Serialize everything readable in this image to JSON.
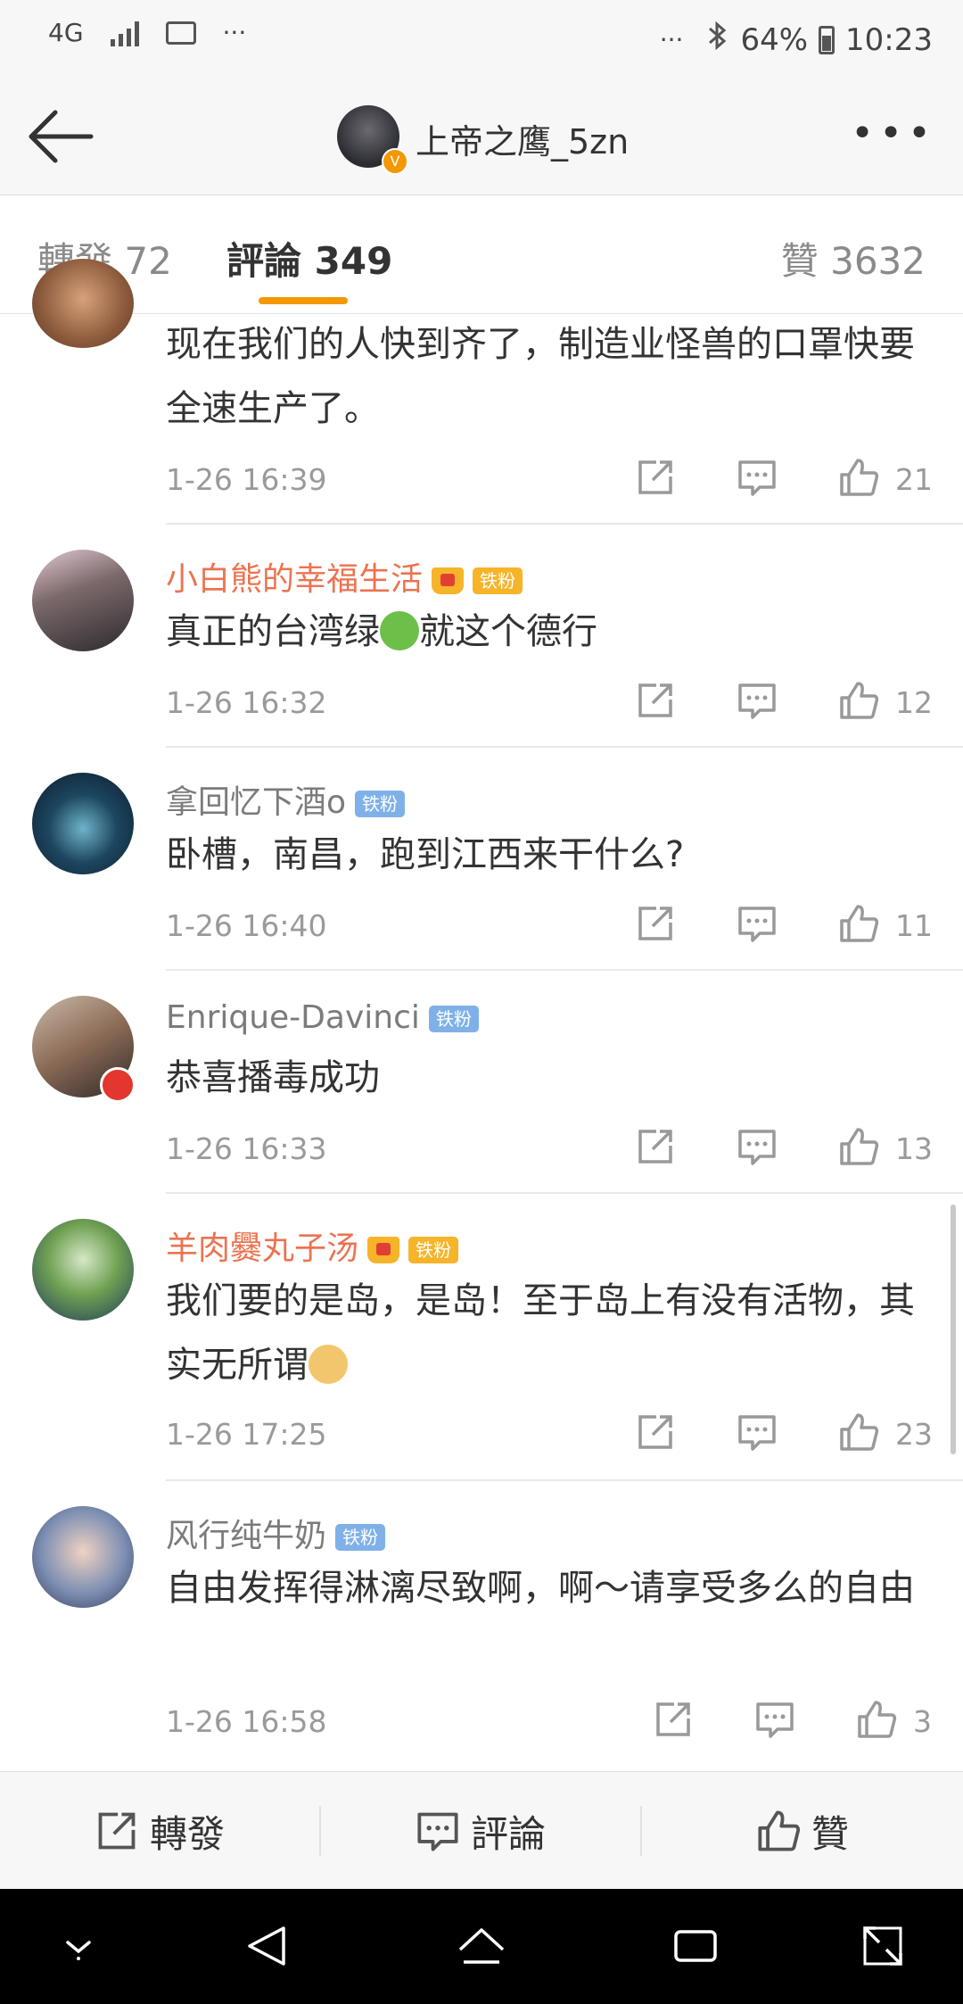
{
  "status_bar": {
    "network": "4G",
    "more": "···",
    "right_more": "···",
    "battery": "64%",
    "time": "10:23"
  },
  "header": {
    "title": "上帝之鹰_5zn",
    "verified_mark": "V"
  },
  "tabs": [
    {
      "label": "轉發 72"
    },
    {
      "label": "評論 349"
    },
    {
      "label": "贊 3632"
    }
  ],
  "comments": [
    {
      "name": "",
      "text": "现在我们的人快到齐了，制造业怪兽的口罩快要全速生产了。",
      "time": "1-26 16:39",
      "likes": "21"
    },
    {
      "name": "小白熊的幸福生活",
      "badge": "铁粉",
      "text_before": "真正的台湾绿",
      "text_after": "就这个德行",
      "time": "1-26 16:32",
      "likes": "12"
    },
    {
      "name": "拿回忆下酒o",
      "badge": "铁粉",
      "text": "卧槽，南昌，跑到江西来干什么?",
      "time": "1-26 16:40",
      "likes": "11"
    },
    {
      "name": "Enrique-Davinci",
      "badge": "铁粉",
      "text": "恭喜播毒成功",
      "time": "1-26 16:33",
      "likes": "13"
    },
    {
      "name": "羊肉爨丸子汤",
      "badge": "铁粉",
      "text_before": "我们要的是岛，是岛！至于岛上有没有活物，其实无所谓",
      "text_after": "",
      "time": "1-26 17:25",
      "likes": "23"
    },
    {
      "name": "风行纯牛奶",
      "badge": "铁粉",
      "text": "自由发挥得淋漓尽致啊，啊～请享受多么的自由",
      "time": "1-26 16:58",
      "likes": "3"
    }
  ],
  "bottom_bar": {
    "repost": "轉發",
    "comment": "評論",
    "like": "贊"
  },
  "colors": {
    "accent": "#f39800",
    "vip_name": "#eb7350",
    "fan_badge_blue": "#7fb1e8",
    "fan_badge_gold": "#f6b42a"
  },
  "icons": [
    "back-arrow-icon",
    "more-icon",
    "share-icon",
    "comment-icon",
    "thumbs-up-icon",
    "frog-emoji-icon",
    "doge-emoji-icon"
  ]
}
